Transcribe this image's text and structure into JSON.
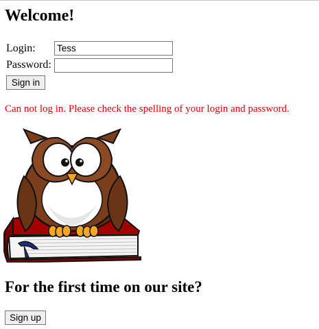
{
  "heading": "Welcome!",
  "login_form": {
    "login_label": "Login:",
    "login_value": "Tess",
    "password_label": "Password:",
    "password_value": "",
    "sign_in_label": "Sign in"
  },
  "error_message": "Can not log in. Please check the spelling of your login and password.",
  "illustration": {
    "subject": "owl-on-book-illustration"
  },
  "signup": {
    "heading": "For the first time on our site?",
    "sign_up_label": "Sign up"
  },
  "colors": {
    "error": "#e00000",
    "owl_brown": "#7a3e1d",
    "book_red": "#8b0000"
  }
}
